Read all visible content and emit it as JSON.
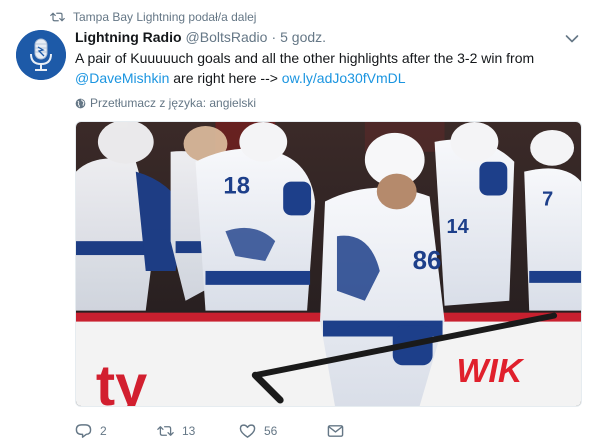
{
  "context": {
    "retweeted_by": "Tampa Bay Lightning podał/a dalej"
  },
  "author": {
    "display_name": "Lightning Radio",
    "handle": "@BoltsRadio",
    "separator": "·",
    "time": "5 godz."
  },
  "tweet": {
    "text_line1": "A pair of Kuuuuuch goals and all the other highlights after the 3-2 win from",
    "mention": "@DaveMishkin",
    "text_line2_mid": " are right here --> ",
    "link": "ow.ly/adJo30fVmDL",
    "translate": "Przetłumacz z języka: angielski"
  },
  "actions": {
    "replies": "2",
    "retweets": "13",
    "likes": "56"
  },
  "icons": {
    "retweet_context": "retweet-icon",
    "caret": "chevron-down-icon",
    "translate": "globe-icon",
    "reply": "reply-icon",
    "retweet": "retweet-icon",
    "like": "heart-icon",
    "dm": "envelope-icon"
  },
  "colors": {
    "text": "#14171a",
    "secondary": "#657786",
    "link": "#1b95e0",
    "avatar_bg": "#1d5aa8"
  }
}
